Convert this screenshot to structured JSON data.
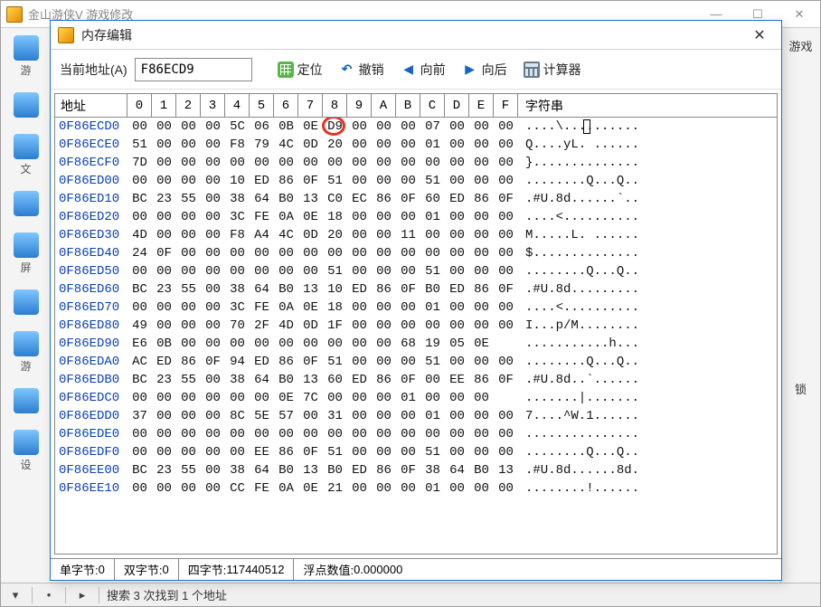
{
  "bg": {
    "title": "金山游侠V   游戏修改",
    "left_items": [
      "游",
      "",
      "文",
      "",
      "屏",
      "",
      "游",
      "",
      "设"
    ],
    "right_tabs": [
      "游戏",
      "锁"
    ],
    "status_text": "搜索 3 次找到 1 个地址"
  },
  "mem": {
    "title": "内存编辑",
    "addr_label": "当前地址(A)",
    "addr_value": "F86ECD9",
    "btn_locate": "定位",
    "btn_undo": "撤销",
    "btn_prev": "向前",
    "btn_next": "向后",
    "btn_calc": "计算器",
    "header_addr": "地址",
    "header_hex": [
      "0",
      "1",
      "2",
      "3",
      "4",
      "5",
      "6",
      "7",
      "8",
      "9",
      "A",
      "B",
      "C",
      "D",
      "E",
      "F"
    ],
    "header_ascii": "字符串",
    "status": {
      "byte_label": "单字节:",
      "byte_val": "0",
      "word_label": "双字节:",
      "word_val": "0",
      "dword_label": "四字节:",
      "dword_val": "117440512",
      "float_label": "浮点数值:",
      "float_val": "0.000000"
    },
    "highlight": {
      "row": 0,
      "col": 8
    },
    "cursor": {
      "row": 0,
      "ascii_index": 8
    },
    "rows": [
      {
        "addr": "0F86ECD0",
        "hex": [
          "00",
          "00",
          "00",
          "00",
          "5C",
          "06",
          "0B",
          "0E",
          "D9",
          "00",
          "00",
          "00",
          "07",
          "00",
          "00",
          "00"
        ],
        "ascii": "....\\.........."
      },
      {
        "addr": "0F86ECE0",
        "hex": [
          "51",
          "00",
          "00",
          "00",
          "F8",
          "79",
          "4C",
          "0D",
          "20",
          "00",
          "00",
          "00",
          "01",
          "00",
          "00",
          "00"
        ],
        "ascii": "Q....yL. ......"
      },
      {
        "addr": "0F86ECF0",
        "hex": [
          "7D",
          "00",
          "00",
          "00",
          "00",
          "00",
          "00",
          "00",
          "00",
          "00",
          "00",
          "00",
          "00",
          "00",
          "00",
          "00"
        ],
        "ascii": "}.............."
      },
      {
        "addr": "0F86ED00",
        "hex": [
          "00",
          "00",
          "00",
          "00",
          "10",
          "ED",
          "86",
          "0F",
          "51",
          "00",
          "00",
          "00",
          "51",
          "00",
          "00",
          "00"
        ],
        "ascii": "........Q...Q.."
      },
      {
        "addr": "0F86ED10",
        "hex": [
          "BC",
          "23",
          "55",
          "00",
          "38",
          "64",
          "B0",
          "13",
          "C0",
          "EC",
          "86",
          "0F",
          "60",
          "ED",
          "86",
          "0F"
        ],
        "ascii": ".#U.8d......`.."
      },
      {
        "addr": "0F86ED20",
        "hex": [
          "00",
          "00",
          "00",
          "00",
          "3C",
          "FE",
          "0A",
          "0E",
          "18",
          "00",
          "00",
          "00",
          "01",
          "00",
          "00",
          "00"
        ],
        "ascii": "....<.........."
      },
      {
        "addr": "0F86ED30",
        "hex": [
          "4D",
          "00",
          "00",
          "00",
          "F8",
          "A4",
          "4C",
          "0D",
          "20",
          "00",
          "00",
          "11",
          "00",
          "00",
          "00",
          "00"
        ],
        "ascii": "M.....L. ......"
      },
      {
        "addr": "0F86ED40",
        "hex": [
          "24",
          "0F",
          "00",
          "00",
          "00",
          "00",
          "00",
          "00",
          "00",
          "00",
          "00",
          "00",
          "00",
          "00",
          "00",
          "00"
        ],
        "ascii": "$.............."
      },
      {
        "addr": "0F86ED50",
        "hex": [
          "00",
          "00",
          "00",
          "00",
          "00",
          "00",
          "00",
          "00",
          "51",
          "00",
          "00",
          "00",
          "51",
          "00",
          "00",
          "00"
        ],
        "ascii": "........Q...Q.."
      },
      {
        "addr": "0F86ED60",
        "hex": [
          "BC",
          "23",
          "55",
          "00",
          "38",
          "64",
          "B0",
          "13",
          "10",
          "ED",
          "86",
          "0F",
          "B0",
          "ED",
          "86",
          "0F"
        ],
        "ascii": ".#U.8d........."
      },
      {
        "addr": "0F86ED70",
        "hex": [
          "00",
          "00",
          "00",
          "00",
          "3C",
          "FE",
          "0A",
          "0E",
          "18",
          "00",
          "00",
          "00",
          "01",
          "00",
          "00",
          "00"
        ],
        "ascii": "....<.........."
      },
      {
        "addr": "0F86ED80",
        "hex": [
          "49",
          "00",
          "00",
          "00",
          "70",
          "2F",
          "4D",
          "0D",
          "1F",
          "00",
          "00",
          "00",
          "00",
          "00",
          "00",
          "00"
        ],
        "ascii": "I...p/M........"
      },
      {
        "addr": "0F86ED90",
        "hex": [
          "E6",
          "0B",
          "00",
          "00",
          "00",
          "00",
          "00",
          "00",
          "00",
          "00",
          "00",
          "68",
          "19",
          "05",
          "0E",
          " "
        ],
        "ascii": "...........h..."
      },
      {
        "addr": "0F86EDA0",
        "hex": [
          "AC",
          "ED",
          "86",
          "0F",
          "94",
          "ED",
          "86",
          "0F",
          "51",
          "00",
          "00",
          "00",
          "51",
          "00",
          "00",
          "00"
        ],
        "ascii": "........Q...Q.."
      },
      {
        "addr": "0F86EDB0",
        "hex": [
          "BC",
          "23",
          "55",
          "00",
          "38",
          "64",
          "B0",
          "13",
          "60",
          "ED",
          "86",
          "0F",
          "00",
          "EE",
          "86",
          "0F"
        ],
        "ascii": ".#U.8d..`......"
      },
      {
        "addr": "0F86EDC0",
        "hex": [
          "00",
          "00",
          "00",
          "00",
          "00",
          "00",
          "0E",
          "7C",
          "00",
          "00",
          "00",
          "01",
          "00",
          "00",
          "00",
          " "
        ],
        "ascii": ".......|......."
      },
      {
        "addr": "0F86EDD0",
        "hex": [
          "37",
          "00",
          "00",
          "00",
          "8C",
          "5E",
          "57",
          "00",
          "31",
          "00",
          "00",
          "00",
          "01",
          "00",
          "00",
          "00"
        ],
        "ascii": "7....^W.1......"
      },
      {
        "addr": "0F86EDE0",
        "hex": [
          "00",
          "00",
          "00",
          "00",
          "00",
          "00",
          "00",
          "00",
          "00",
          "00",
          "00",
          "00",
          "00",
          "00",
          "00",
          "00"
        ],
        "ascii": "..............."
      },
      {
        "addr": "0F86EDF0",
        "hex": [
          "00",
          "00",
          "00",
          "00",
          "00",
          "EE",
          "86",
          "0F",
          "51",
          "00",
          "00",
          "00",
          "51",
          "00",
          "00",
          "00"
        ],
        "ascii": "........Q...Q.."
      },
      {
        "addr": "0F86EE00",
        "hex": [
          "BC",
          "23",
          "55",
          "00",
          "38",
          "64",
          "B0",
          "13",
          "B0",
          "ED",
          "86",
          "0F",
          "38",
          "64",
          "B0",
          "13"
        ],
        "ascii": ".#U.8d......8d."
      },
      {
        "addr": "0F86EE10",
        "hex": [
          "00",
          "00",
          "00",
          "00",
          "CC",
          "FE",
          "0A",
          "0E",
          "21",
          "00",
          "00",
          "00",
          "01",
          "00",
          "00",
          "00"
        ],
        "ascii": "........!......"
      }
    ]
  }
}
